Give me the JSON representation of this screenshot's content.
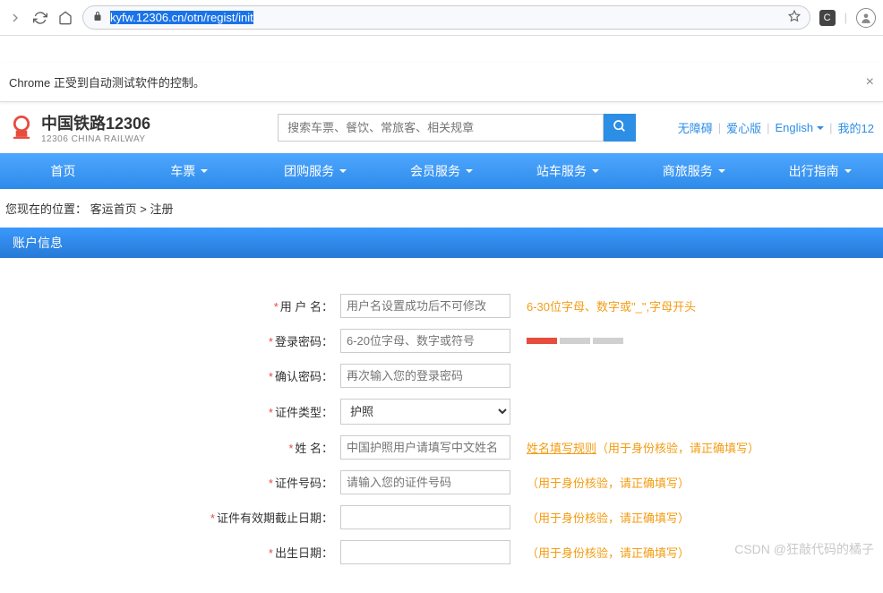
{
  "browser": {
    "url_plain": "",
    "url_selected": "kyfw.12306.cn/otn/regist/init",
    "notification": "Chrome 正受到自动测试软件的控制。"
  },
  "header": {
    "logo_cn": "中国铁路12306",
    "logo_en": "12306 CHINA RAILWAY",
    "search_placeholder": "搜索车票、餐饮、常旅客、相关规章",
    "links": {
      "accessible": "无障碍",
      "care": "爱心版",
      "english": "English",
      "my12": "我的12",
      "sep": "|"
    }
  },
  "nav": {
    "items": [
      "首页",
      "车票",
      "团购服务",
      "会员服务",
      "站车服务",
      "商旅服务",
      "出行指南"
    ]
  },
  "breadcrumb": {
    "prefix": "您现在的位置：",
    "home": "客运首页",
    "sep": " > ",
    "current": "注册"
  },
  "section_title": "账户信息",
  "form": {
    "rows": [
      {
        "label": "用 户 名：",
        "placeholder": "用户名设置成功后不可修改",
        "hint": "6-30位字母、数字或\"_\",字母开头",
        "type": "text"
      },
      {
        "label": "登录密码：",
        "placeholder": "6-20位字母、数字或符号",
        "type": "text",
        "strength": true
      },
      {
        "label": "确认密码：",
        "placeholder": "再次输入您的登录密码",
        "type": "text"
      },
      {
        "label": "证件类型：",
        "value": "护照",
        "type": "select"
      },
      {
        "label": "姓 名：",
        "placeholder": "中国护照用户请填写中文姓名",
        "type": "text",
        "hint_link": "姓名填写规则",
        "hint_rest": "（用于身份核验，请正确填写）"
      },
      {
        "label": "证件号码：",
        "placeholder": "请输入您的证件号码",
        "type": "text",
        "hint": "（用于身份核验，请正确填写）"
      },
      {
        "label": "证件有效期截止日期：",
        "placeholder": "",
        "type": "text",
        "hint": "（用于身份核验，请正确填写）"
      },
      {
        "label": "出生日期：",
        "placeholder": "",
        "type": "text",
        "hint": "（用于身份核验，请正确填写）"
      }
    ]
  },
  "watermark": "CSDN @狂敲代码的橘子"
}
